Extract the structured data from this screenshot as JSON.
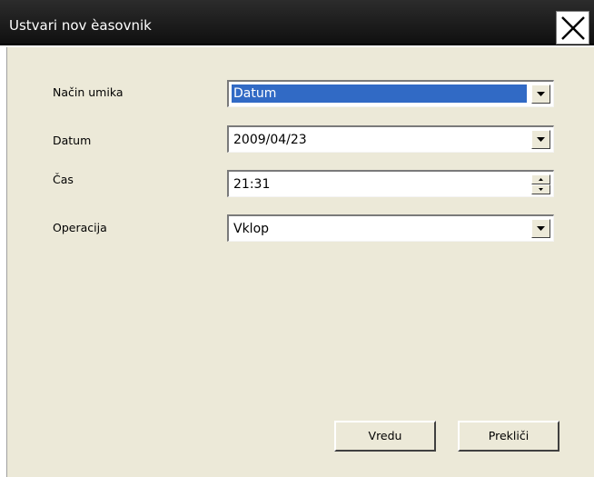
{
  "window": {
    "title": "Ustvari nov èasovnik",
    "close_icon": "close-x-icon"
  },
  "form": {
    "mode": {
      "label": "Način umika",
      "value": "Datum"
    },
    "date": {
      "label": "Datum",
      "value": "2009/04/23"
    },
    "time": {
      "label": "Čas",
      "value": "21:31"
    },
    "operation": {
      "label": "Operacija",
      "value": "Vklop"
    }
  },
  "buttons": {
    "ok": "Vredu",
    "cancel": "Prekliči"
  },
  "colors": {
    "titlebar": "#1c1c1c",
    "dialog_bg": "#ece9d8",
    "selection": "#316ac5"
  }
}
